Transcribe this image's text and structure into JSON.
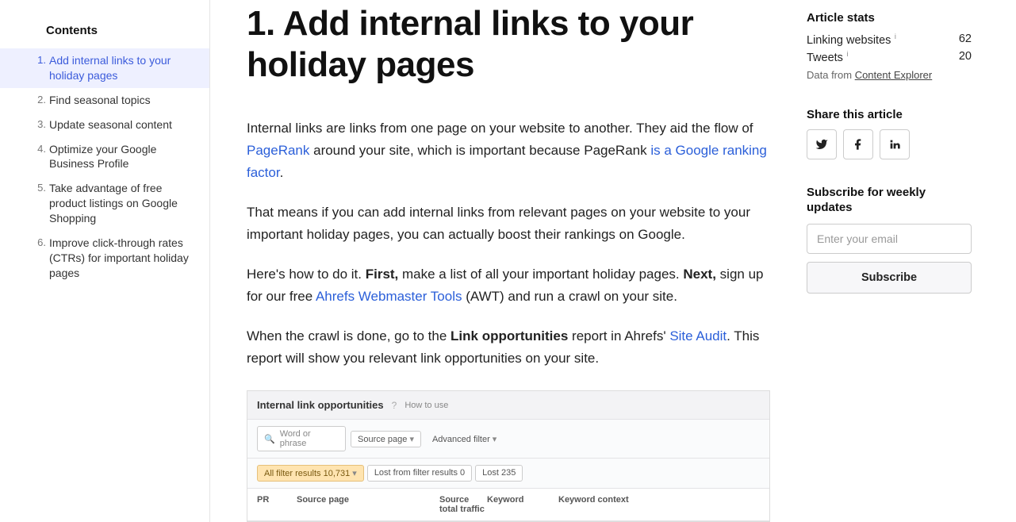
{
  "toc": {
    "heading": "Contents",
    "items": [
      {
        "num": "1.",
        "label": "Add internal links to your holiday pages",
        "active": true
      },
      {
        "num": "2.",
        "label": "Find seasonal topics",
        "active": false
      },
      {
        "num": "3.",
        "label": "Update seasonal content",
        "active": false
      },
      {
        "num": "4.",
        "label": "Optimize your Google Business Profile",
        "active": false
      },
      {
        "num": "5.",
        "label": "Take advantage of free product listings on Google Shopping",
        "active": false
      },
      {
        "num": "6.",
        "label": "Improve click-through rates (CTRs) for important holiday pages",
        "active": false
      }
    ]
  },
  "article": {
    "title": "1. Add internal links to your holiday pages",
    "p1_a": "Internal links are links from one page on your website to another. They aid the flow of ",
    "p1_link1": "PageRank",
    "p1_b": " around your site, which is important because PageRank ",
    "p1_link2": "is a Google ranking factor",
    "p1_c": ".",
    "p2": "That means if you can add internal links from relevant pages on your website to your important holiday pages, you can actually boost their rankings on Google.",
    "p3_a": "Here's how to do it. ",
    "p3_b1": "First,",
    "p3_c": " make a list of all your important holiday pages. ",
    "p3_b2": "Next,",
    "p3_d": " sign up for our free ",
    "p3_link": "Ahrefs Webmaster Tools",
    "p3_e": " (AWT) and run a crawl on your site.",
    "p4_a": "When the crawl is done, go to the ",
    "p4_b1": "Link opportunities",
    "p4_b": " report in Ahrefs' ",
    "p4_link": "Site Audit",
    "p4_c": ". This report will show you relevant link opportunities on your site."
  },
  "screenshot": {
    "title": "Internal link opportunities",
    "help": "How to use",
    "search_placeholder": "Word or phrase",
    "filter_source": "Source page",
    "filter_adv": "Advanced filter",
    "tab_all_a": "All filter results ",
    "tab_all_b": "10,731",
    "tab_lostfilter_a": "Lost from filter results ",
    "tab_lostfilter_b": "0",
    "tab_lost_a": "Lost ",
    "tab_lost_b": "235",
    "col_pr": "PR",
    "col_source": "Source page",
    "col_traffic": "Source total traffic",
    "col_keyword": "Keyword",
    "col_context": "Keyword context"
  },
  "stats": {
    "heading": "Article stats",
    "linking_label": "Linking websites",
    "linking_val": "62",
    "tweets_label": "Tweets",
    "tweets_val": "20",
    "data_from_a": "Data from ",
    "data_from_link": "Content Explorer"
  },
  "share": {
    "heading": "Share this article"
  },
  "subscribe": {
    "heading": "Subscribe for weekly updates",
    "placeholder": "Enter your email",
    "button": "Subscribe"
  }
}
